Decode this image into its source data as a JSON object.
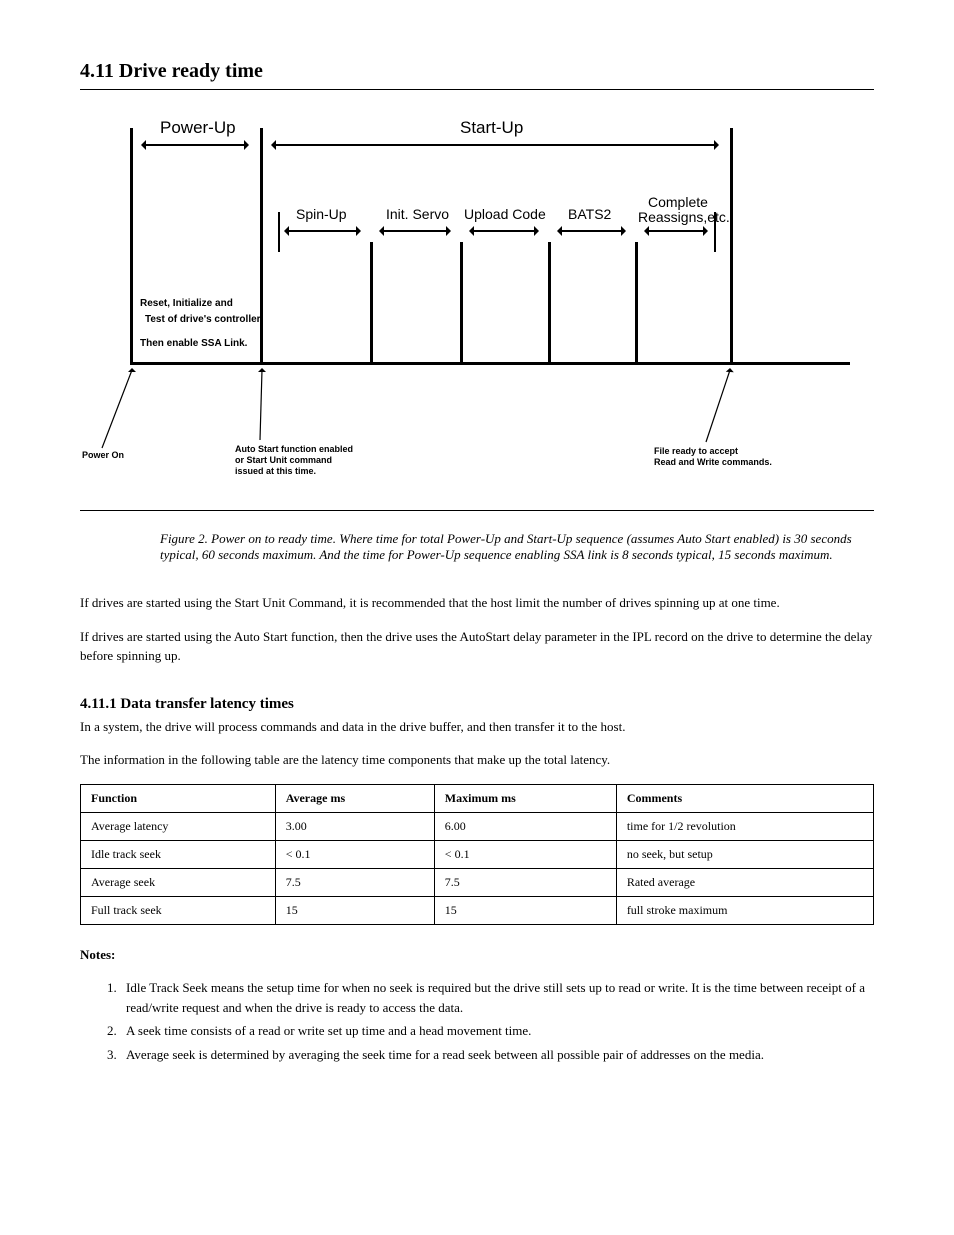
{
  "section": {
    "number": "4.11",
    "title": "Drive ready time"
  },
  "diagram": {
    "phase1": "Power-Up",
    "phase2": "Start-Up",
    "sub": {
      "spinup": "Spin-Up",
      "servo": "Init. Servo",
      "upload": "Upload Code",
      "bats2": "BATS2",
      "complete_l1": "Complete",
      "complete_l2": "Reassigns,etc."
    },
    "box": {
      "l1": "Reset, Initialize and",
      "l2": "Test of drive's controller.",
      "l3": "Then enable SSA Link."
    },
    "callouts": {
      "poweron": "Power On",
      "auto_l1": "Auto Start function enabled",
      "auto_l2": "or Start Unit command",
      "auto_l3": "issued at this time.",
      "ready_l1": "File ready to accept",
      "ready_l2": "Read and Write commands."
    }
  },
  "figure_caption": "Figure 2. Power on to ready time. Where time for total Power-Up and Start-Up sequence (assumes Auto Start enabled) is 30 seconds typical, 60 seconds maximum. And the time for Power-Up sequence enabling SSA link is 8 seconds typical, 15 seconds maximum.",
  "after_fig_p1": "If drives are started using the Start Unit Command, it is recommended that the host limit the number of drives spinning up at one time.",
  "after_fig_p2": "If drives are started using the Auto Start function, then the drive uses the AutoStart delay parameter in the IPL record on the drive to determine the delay before spinning up.",
  "subhead_latency": "4.11.1 Data transfer latency times",
  "latency_p1": "In a system, the drive will process commands and data in the drive buffer, and then transfer it to the host.",
  "latency_p2": "The information in the following table are the latency time components that make up the total latency.",
  "table": {
    "headers": [
      "Function",
      "Average ms",
      "Maximum ms",
      "Comments"
    ],
    "rows": [
      [
        "Average latency",
        "3.00",
        "6.00",
        "time for 1/2 revolution"
      ],
      [
        "Idle track seek",
        "< 0.1",
        "< 0.1",
        "no seek, but setup"
      ],
      [
        "Average seek",
        "7.5",
        "7.5",
        "Rated average"
      ],
      [
        "Full track seek",
        "15",
        "15",
        "full stroke maximum"
      ]
    ]
  },
  "notes_label": "Notes:",
  "notes": [
    "Idle Track Seek means the setup time for when no seek is required but the drive still sets up to read or write. It is the time between receipt of a read/write request and when the drive is ready to access the data.",
    "A seek time consists of a read or write set up time and a head movement time.",
    "Average seek is determined by averaging the seek time for a read seek between all possible pair of addresses on the media."
  ]
}
